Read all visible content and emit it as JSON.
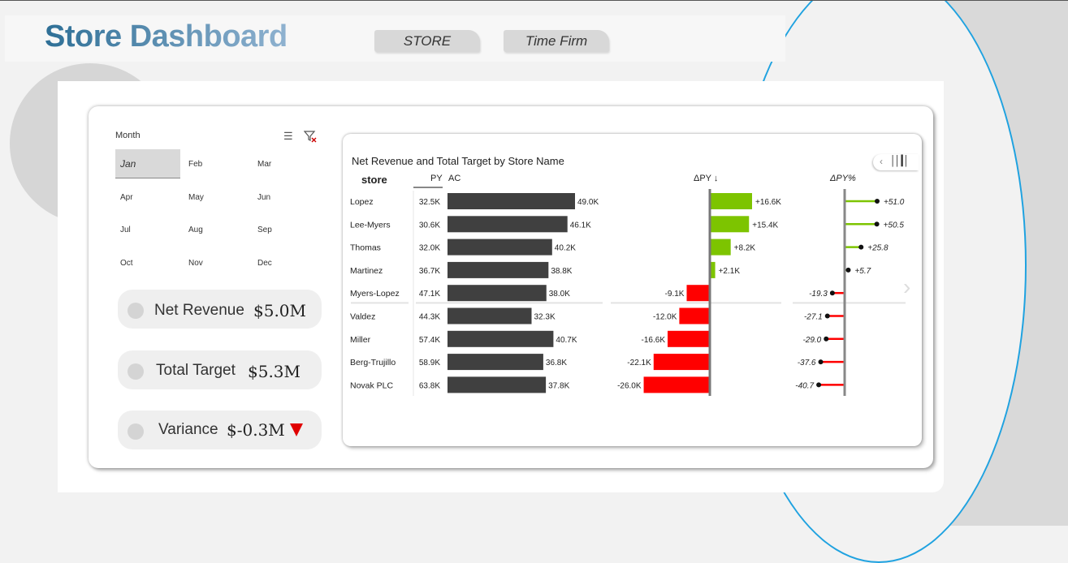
{
  "header": {
    "title": "Store Dashboard",
    "buttons": [
      {
        "label": "STORE"
      },
      {
        "label": "Time Firm"
      }
    ]
  },
  "slicer": {
    "title": "Month",
    "selected": "Jan",
    "months": [
      "Jan",
      "Feb",
      "Mar",
      "Apr",
      "May",
      "Jun",
      "Jul",
      "Aug",
      "Sep",
      "Oct",
      "Nov",
      "Dec"
    ]
  },
  "kpis": [
    {
      "label": "Net Revenue",
      "value": "$5.0M"
    },
    {
      "label": "Total Target",
      "value": "$5.3M"
    },
    {
      "label": "Variance",
      "value": "$-0.3M",
      "trend": "down",
      "trend_color": "#e00000"
    }
  ],
  "colors": {
    "bar_dark": "#404040",
    "positive": "#7dc400",
    "negative": "#ff0000",
    "accent": "#1fa2e0"
  },
  "chart_data": {
    "type": "bar",
    "title": "Net Revenue and Total Target by Store Name",
    "headers": {
      "store": "store",
      "py": "PY",
      "ac": "AC",
      "dpy": "ΔPY ↓",
      "dpy_pct": "ΔPY%"
    },
    "categories": [
      "Lopez",
      "Lee-Myers",
      "Thomas",
      "Martinez",
      "Myers-Lopez",
      "Valdez",
      "Miller",
      "Berg-Trujillo",
      "Novak PLC"
    ],
    "series": [
      {
        "name": "PY",
        "values": [
          32.5,
          30.6,
          32.0,
          36.7,
          47.1,
          44.3,
          57.4,
          58.9,
          63.8
        ],
        "labels": [
          "32.5K",
          "30.6K",
          "32.0K",
          "36.7K",
          "47.1K",
          "44.3K",
          "57.4K",
          "58.9K",
          "63.8K"
        ]
      },
      {
        "name": "AC",
        "values": [
          49.0,
          46.1,
          40.2,
          38.8,
          38.0,
          32.3,
          40.7,
          36.8,
          37.8
        ],
        "labels": [
          "49.0K",
          "46.1K",
          "40.2K",
          "38.8K",
          "38.0K",
          "32.3K",
          "40.7K",
          "36.8K",
          "37.8K"
        ]
      },
      {
        "name": "ΔPY",
        "values": [
          16.6,
          15.4,
          8.2,
          2.1,
          -9.1,
          -12.0,
          -16.6,
          -22.1,
          -26.0
        ],
        "labels": [
          "+16.6K",
          "+15.4K",
          "+8.2K",
          "+2.1K",
          "-9.1K",
          "-12.0K",
          "-16.6K",
          "-22.1K",
          "-26.0K"
        ]
      },
      {
        "name": "ΔPY%",
        "values": [
          51.0,
          50.5,
          25.8,
          5.7,
          -19.3,
          -27.1,
          -29.0,
          -37.6,
          -40.7
        ],
        "labels": [
          "+51.0",
          "+50.5",
          "+25.8",
          "+5.7",
          "-19.3",
          "-27.1",
          "-29.0",
          "-37.6",
          "-40.7"
        ]
      }
    ]
  }
}
